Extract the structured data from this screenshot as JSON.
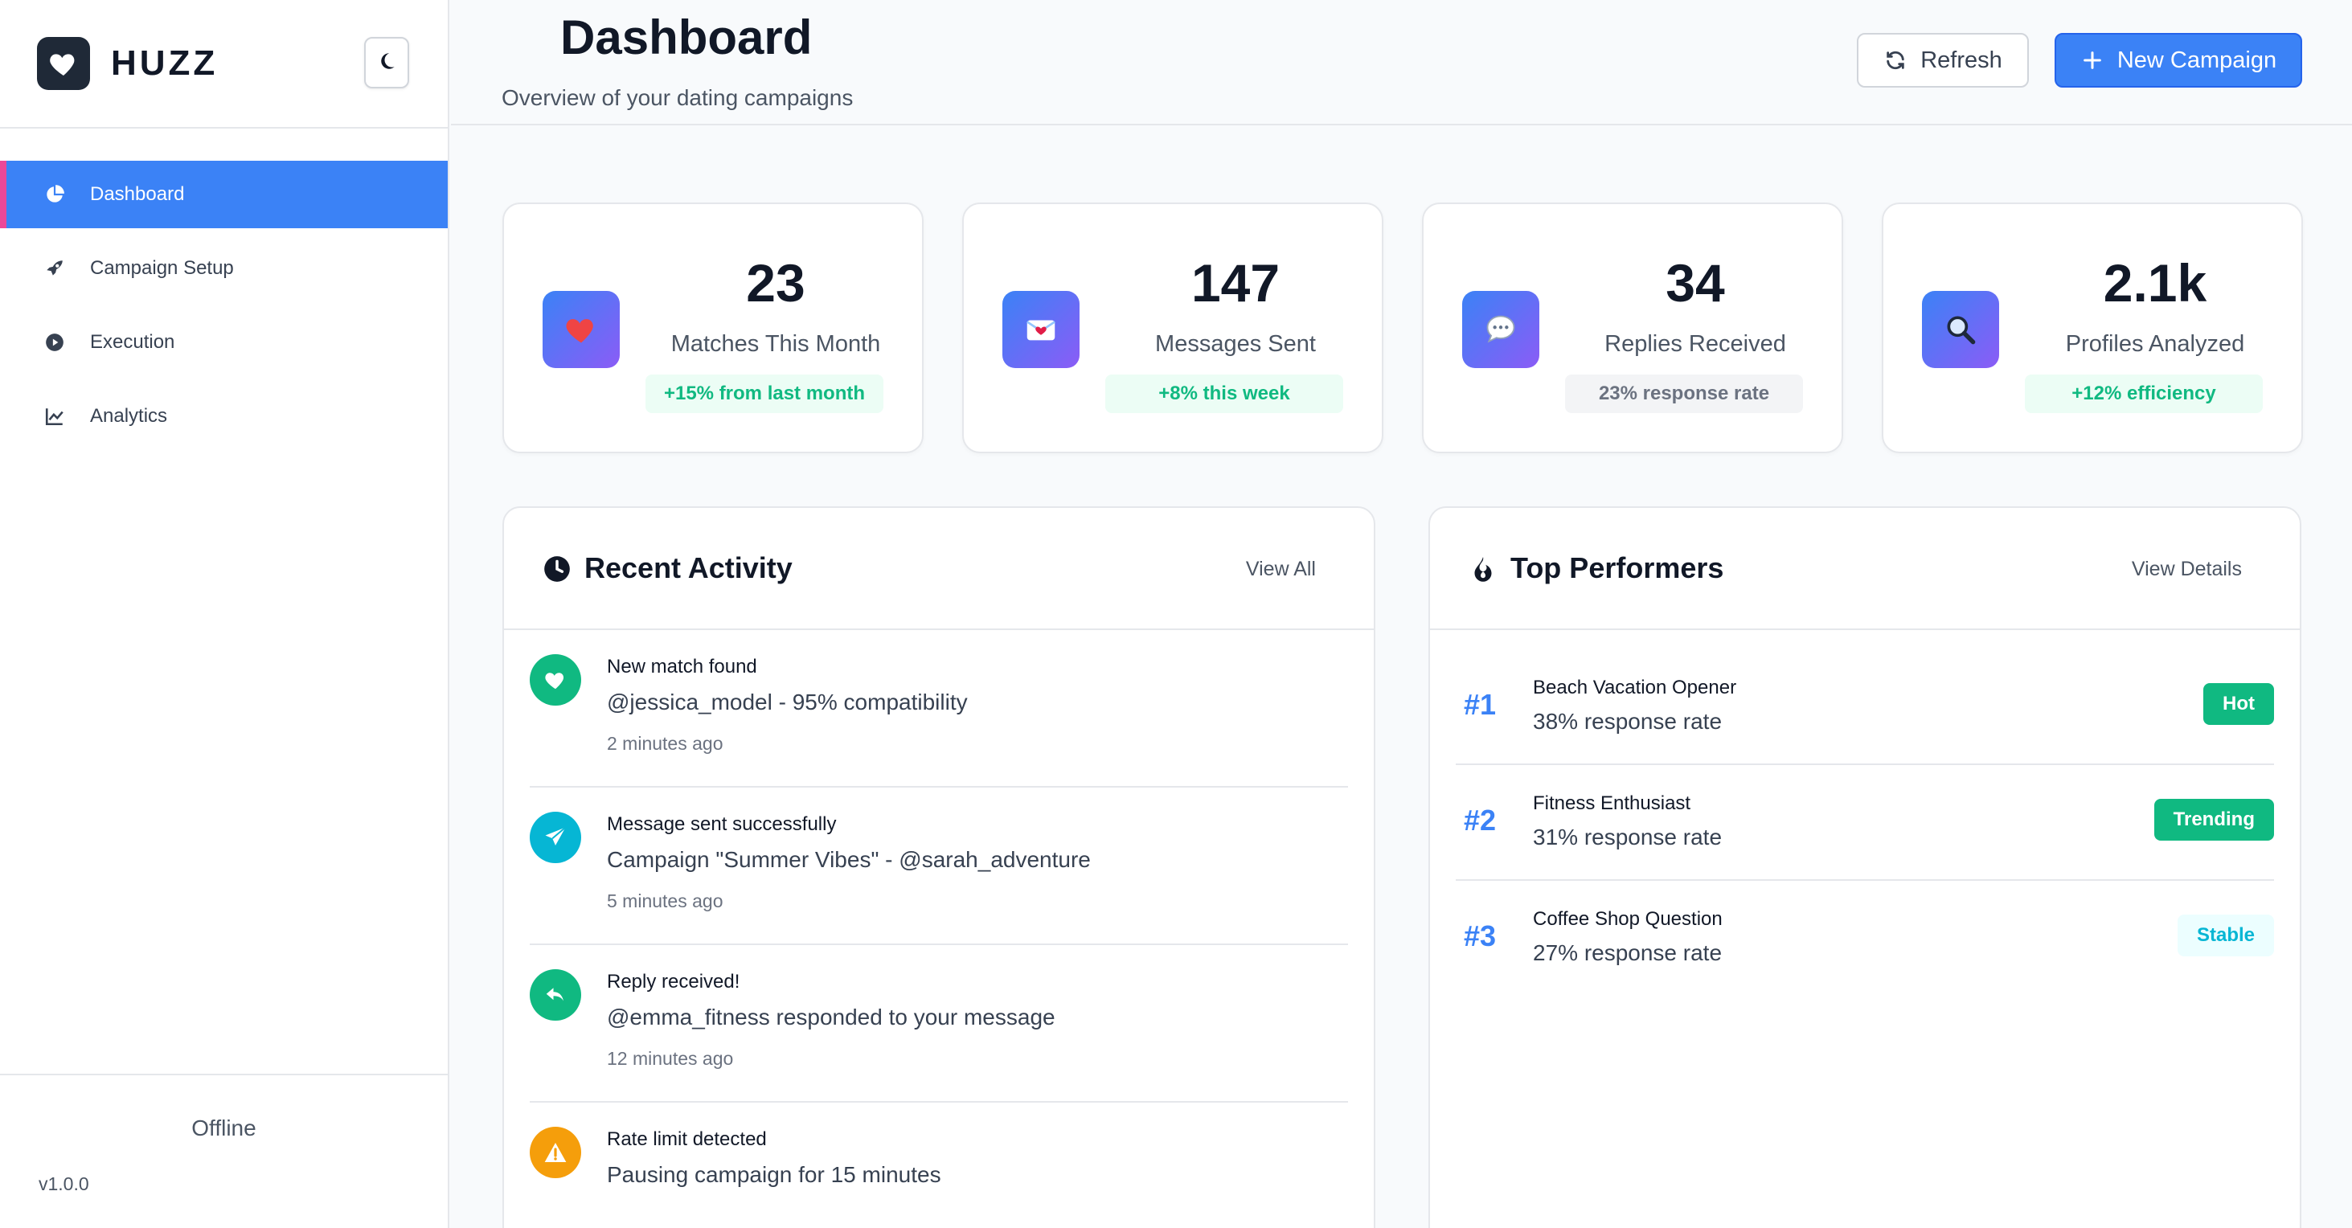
{
  "brand": {
    "name": "HUZZ"
  },
  "sidebar": {
    "items": [
      {
        "label": "Dashboard"
      },
      {
        "label": "Campaign Setup"
      },
      {
        "label": "Execution"
      },
      {
        "label": "Analytics"
      }
    ],
    "status": "Offline",
    "version": "v1.0.0"
  },
  "header": {
    "title": "Dashboard",
    "subtitle": "Overview of your dating campaigns",
    "refresh_label": "Refresh",
    "new_campaign_label": "New Campaign"
  },
  "stats": [
    {
      "value": "23",
      "label": "Matches This Month",
      "badge": "+15% from last month",
      "icon": "heart-icon"
    },
    {
      "value": "147",
      "label": "Messages Sent",
      "badge": "+8% this week",
      "icon": "envelope-icon"
    },
    {
      "value": "34",
      "label": "Replies Received",
      "badge": "23% response rate",
      "icon": "speech-bubble-icon"
    },
    {
      "value": "2.1k",
      "label": "Profiles Analyzed",
      "badge": "+12% efficiency",
      "icon": "magnifier-icon"
    }
  ],
  "recent_activity": {
    "title": "Recent Activity",
    "link": "View All",
    "items": [
      {
        "title": "New match found",
        "desc": "@jessica_model - 95% compatibility",
        "time": "2 minutes ago",
        "color": "#10b981"
      },
      {
        "title": "Message sent successfully",
        "desc": "Campaign \"Summer Vibes\" - @sarah_adventure",
        "time": "5 minutes ago",
        "color": "#06b6d4"
      },
      {
        "title": "Reply received!",
        "desc": "@emma_fitness responded to your message",
        "time": "12 minutes ago",
        "color": "#10b981"
      },
      {
        "title": "Rate limit detected",
        "desc": "Pausing campaign for 15 minutes",
        "time": "",
        "color": "#f59e0b"
      }
    ]
  },
  "top_performers": {
    "title": "Top Performers",
    "link": "View Details",
    "items": [
      {
        "rank": "#1",
        "name": "Beach Vacation Opener",
        "rate": "38% response rate",
        "badge": "Hot"
      },
      {
        "rank": "#2",
        "name": "Fitness Enthusiast",
        "rate": "31% response rate",
        "badge": "Trending"
      },
      {
        "rank": "#3",
        "name": "Coffee Shop Question",
        "rate": "27% response rate",
        "badge": "Stable"
      }
    ]
  },
  "colors": {
    "accent": "#3b82f6",
    "active_marker": "#ec4899",
    "success": "#10b981",
    "warning": "#f59e0b",
    "info": "#06b6d4"
  }
}
